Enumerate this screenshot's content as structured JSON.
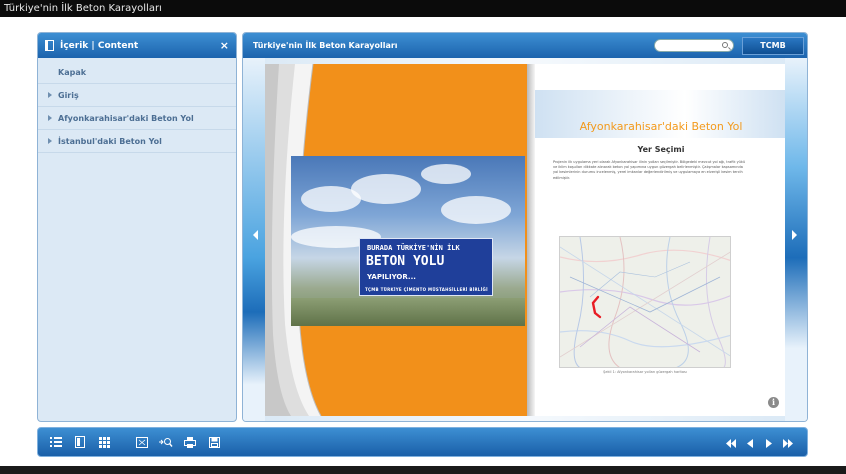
{
  "window": {
    "title": "Türkiye'nin İlk Beton Karayolları"
  },
  "sidebar": {
    "header": "İçerik | Content",
    "close_glyph": "×",
    "items": [
      {
        "label": "Kapak",
        "has_children": false
      },
      {
        "label": "Giriş",
        "has_children": true
      },
      {
        "label": "Afyonkarahisar'daki Beton Yol",
        "has_children": true
      },
      {
        "label": "İstanbul'daki Beton Yol",
        "has_children": true
      }
    ]
  },
  "viewer": {
    "title": "Türkiye'nin İlk Beton Karayolları",
    "search": {
      "value": "",
      "placeholder": ""
    },
    "tcmb_label": "TCMB"
  },
  "book": {
    "left_page": {
      "billboard_line1": "BURADA TÜRKİYE'NİN İLK",
      "billboard_line2": "BETON YOLU",
      "billboard_line3": "YAPILIYOR...",
      "billboard_line4": "TÇMB   TÜRKİYE ÇİMENTO MÜSTAHSİLLERİ BİRLİĞİ"
    },
    "right_page": {
      "heading": "Afyonkarahisar'daki Beton Yol",
      "subheading": "Yer Seçimi",
      "body": "Projenin ilk uygulama yeri olarak Afyonkarahisar ilinin yolları seçilmiştir. Bölgedeki mevcut yol ağı, trafik yükü ve iklim koşulları dikkate alınarak beton yol yapımına uygun güzergah belirlenmiştir. Çalışmalar kapsamında yol kesimlerinin durumu incelenmiş, yerel imkanlar değerlendirilmiş ve uygulamaya en elverişli kesim tercih edilmiştir.",
      "map_caption": "Şekil 1: Afyonkarahisar yolları güzergah haritası",
      "info_glyph": "i"
    }
  },
  "toolbar": {
    "icons": [
      "list-icon",
      "bookmark-icon",
      "grid-icon",
      "fullscreen-icon",
      "zoom-icon",
      "print-icon",
      "save-icon"
    ],
    "nav": [
      "first-page-icon",
      "prev-page-icon",
      "next-page-icon",
      "last-page-icon"
    ]
  },
  "colors": {
    "header_blue": "#1c63ad",
    "sidebar_bg": "#dce9f5",
    "orange": "#f2901a",
    "heading_orange": "#f39a1c",
    "billboard_blue": "#1f3f9a"
  }
}
